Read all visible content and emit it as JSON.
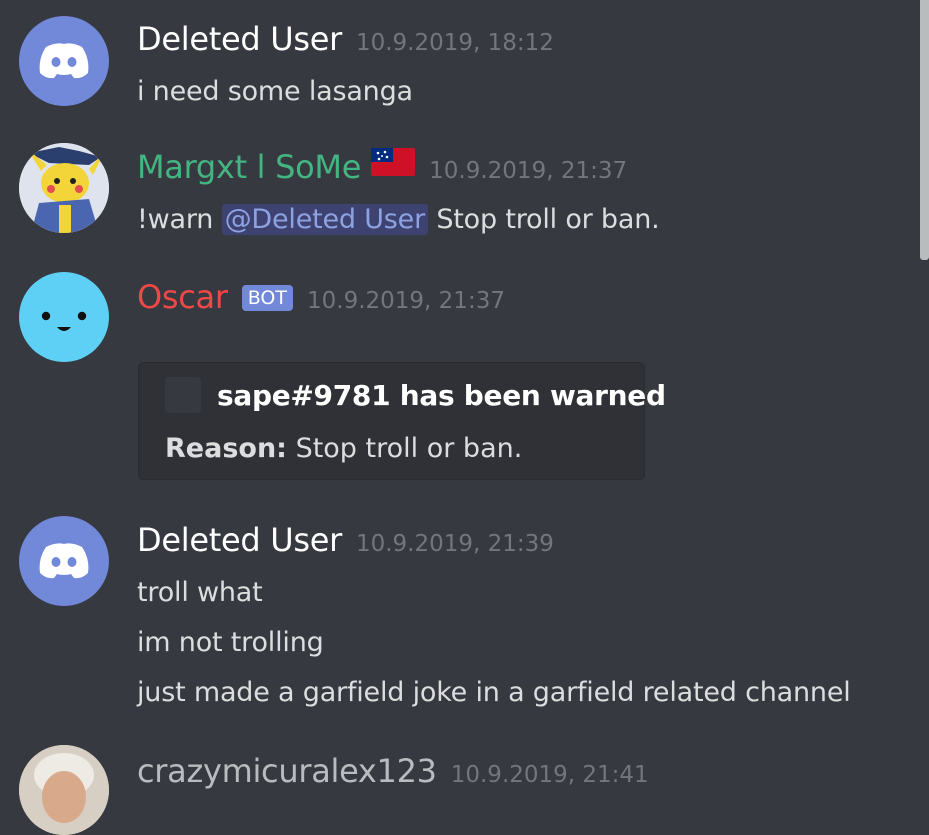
{
  "colors": {
    "background": "#36393f",
    "mod_name": "#43b581",
    "bot_name": "#f04747",
    "mention": "#8ea1e1",
    "bot_tag": "#7289da",
    "last_name": "#b9bbbe"
  },
  "messages": [
    {
      "avatar_icon": "discord-logo-icon",
      "username": "Deleted User",
      "timestamp": "10.9.2019, 18:12",
      "lines": [
        "i need some lasanga"
      ]
    },
    {
      "avatar_icon": "pikachu-avatar",
      "username": "Margxt l SoMe",
      "flag_icon": "samoa-flag-icon",
      "timestamp": "10.9.2019, 21:37",
      "line_prefix": "!warn",
      "mention": "@Deleted User",
      "line_suffix": "Stop troll or ban."
    },
    {
      "avatar_icon": "blue-face-avatar",
      "username": "Oscar",
      "tag": "BOT",
      "timestamp": "10.9.2019, 21:37",
      "embed": {
        "title": "sape#9781 has been warned",
        "reason_label": "Reason:",
        "reason_text": "Stop troll or ban."
      }
    },
    {
      "avatar_icon": "discord-logo-icon",
      "username": "Deleted User",
      "timestamp": "10.9.2019, 21:39",
      "lines": [
        "troll what",
        "im not trolling",
        "just made a garfield joke in a garfield related channel"
      ]
    },
    {
      "avatar_icon": "old-man-avatar",
      "username": "crazymicuralex123",
      "timestamp": "10.9.2019, 21:41"
    }
  ]
}
